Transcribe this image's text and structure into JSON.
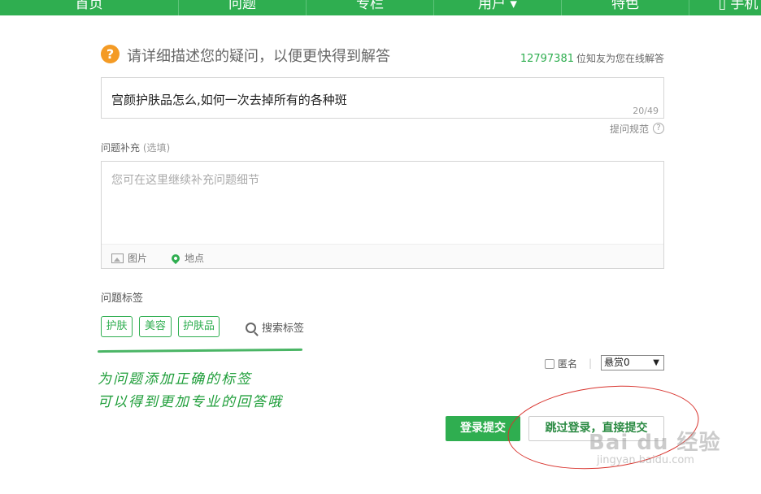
{
  "nav": {
    "items": [
      "首页",
      "问题",
      "专栏",
      "用户 ▾",
      "特色",
      "▯ 手机"
    ]
  },
  "header": {
    "help_icon": "question-mark-icon",
    "prompt": "请详细描述您的疑问，以便更快得到解答",
    "online_count": "12797381",
    "online_text": "位知友为您在线解答"
  },
  "question": {
    "title_value": "宫颜护肤品怎么,如何一次去掉所有的各种斑",
    "counter": "20/49"
  },
  "rules": {
    "link": "提问规范",
    "help": "?"
  },
  "supplement": {
    "label": "问题补充",
    "optional": "(选填)",
    "placeholder": "您可在这里继续补充问题细节",
    "toolbar_image": "图片",
    "toolbar_location": "地点"
  },
  "tags": {
    "label": "问题标签",
    "items": [
      "护肤",
      "美容",
      "护肤品"
    ],
    "search": "搜索标签"
  },
  "annotation": {
    "line1": "为问题添加正确的标签",
    "line2": "可以得到更加专业的回答哦"
  },
  "options": {
    "anonymous": "匿名",
    "separator": "|",
    "reward": "悬赏0",
    "reward_arrow": "▼"
  },
  "actions": {
    "login_submit": "登录提交",
    "skip_login": "跳过登录，直接提交"
  },
  "watermark": {
    "logo": "Bai du 经验",
    "url": "jingyan.baidu.com"
  },
  "colors": {
    "brand_green": "#2fae50",
    "help_orange": "#f49b25",
    "annotation_red": "#d8322c"
  }
}
